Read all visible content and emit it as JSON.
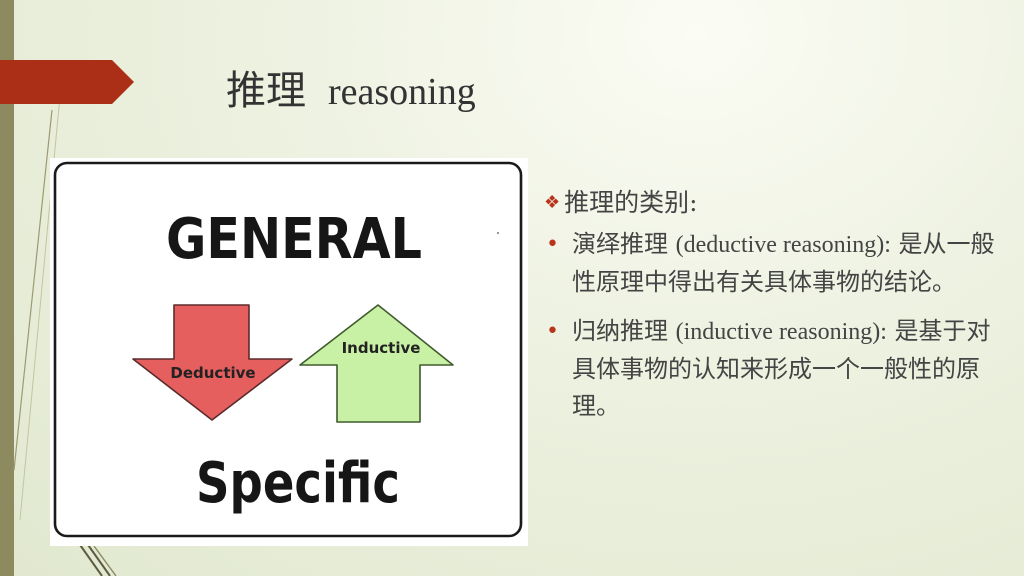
{
  "slide": {
    "title_zh": "推理",
    "title_en": "reasoning"
  },
  "diagram": {
    "top_word": "GENERAL",
    "bottom_word": "Specific",
    "left_arrow_label": "Deductive",
    "right_arrow_label": "Inductive",
    "colors": {
      "deductive_arrow": "#e65f5f",
      "inductive_arrow": "#c9f1a5"
    }
  },
  "content": {
    "category_heading": "推理的类别:",
    "bullets": [
      {
        "lead": "演绎推理",
        "english": "(deductive reasoning):",
        "body": "是从一般性原理中得出有关具体事物的结论。"
      },
      {
        "lead": "归纳推理",
        "english": "(inductive reasoning):",
        "body": "是基于对具体事物的认知来形成一个一般性的原理。"
      }
    ]
  },
  "colors": {
    "accent_red": "#b8341b",
    "side_bar": "#8d8a60"
  }
}
